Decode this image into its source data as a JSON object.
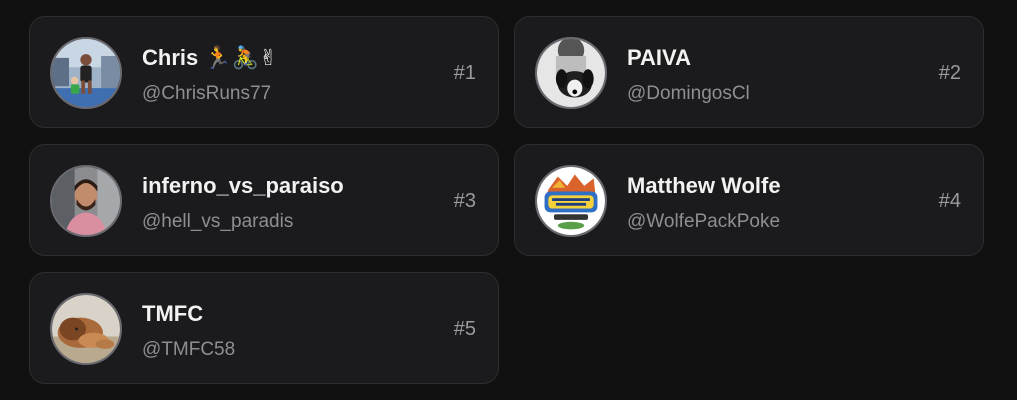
{
  "cards": [
    {
      "name": "Chris 🏃🚴✌",
      "handle": "@ChrisRuns77",
      "rank": "#1",
      "avatar_icon": "runner-photo-avatar"
    },
    {
      "name": "PAIVA",
      "handle": "@DomingosCl",
      "rank": "#2",
      "avatar_icon": "dog-photo-avatar"
    },
    {
      "name": "inferno_vs_paraiso",
      "handle": "@hell_vs_paradis",
      "rank": "#3",
      "avatar_icon": "car-selfie-avatar"
    },
    {
      "name": "Matthew Wolfe",
      "handle": "@WolfePackPoke",
      "rank": "#4",
      "avatar_icon": "wolfe-pack-poke-logo-avatar"
    },
    {
      "name": "TMFC",
      "handle": "@TMFC58",
      "rank": "#5",
      "avatar_icon": "lion-photo-avatar"
    }
  ],
  "colors": {
    "background": "#111111",
    "card": "#1b1b1d",
    "card_border": "#2e2e31",
    "name_text": "#f2f2f2",
    "handle_text": "#8e8e93"
  }
}
